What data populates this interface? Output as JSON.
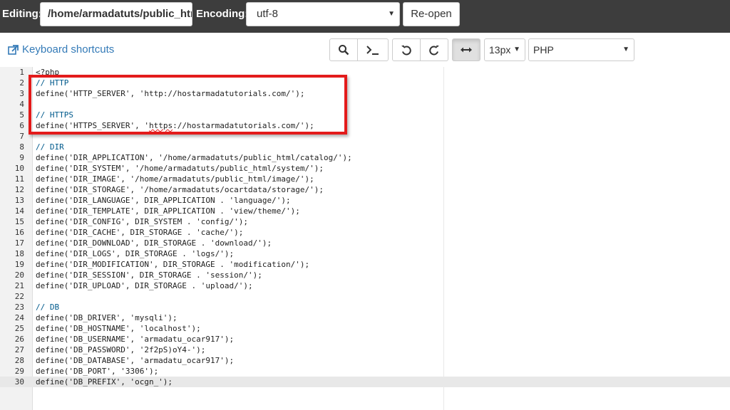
{
  "topbar": {
    "editing_label": "Editing:",
    "path_value": "/home/armadatuts/public_html",
    "encoding_label": "Encoding:",
    "encoding_value": "utf-8",
    "reopen_label": "Re-open"
  },
  "toolbar": {
    "keyboard_shortcuts_label": "Keyboard shortcuts",
    "font_size_value": "13px",
    "mode_value": "PHP",
    "icons": [
      "search-icon",
      "terminal-icon",
      "undo-icon",
      "redo-icon",
      "wrap-icon"
    ]
  },
  "colors": {
    "topbar": "#3d3d3d",
    "link": "#337ab7",
    "highlight_box": "#e31b1b"
  },
  "editor": {
    "active_line": 30,
    "lines": [
      {
        "n": "1",
        "t": "<?php"
      },
      {
        "n": "2",
        "t": "// HTTP"
      },
      {
        "n": "3",
        "t": "define('HTTP_SERVER', 'http://hostarmadatutorials.com/');"
      },
      {
        "n": "4",
        "t": ""
      },
      {
        "n": "5",
        "t": "// HTTPS"
      },
      {
        "n": "6",
        "t": "define('HTTPS_SERVER', 'https://hostarmadatutorials.com/');"
      },
      {
        "n": "7",
        "t": ""
      },
      {
        "n": "8",
        "t": "// DIR"
      },
      {
        "n": "9",
        "t": "define('DIR_APPLICATION', '/home/armadatuts/public_html/catalog/');"
      },
      {
        "n": "10",
        "t": "define('DIR_SYSTEM', '/home/armadatuts/public_html/system/');"
      },
      {
        "n": "11",
        "t": "define('DIR_IMAGE', '/home/armadatuts/public_html/image/');"
      },
      {
        "n": "12",
        "t": "define('DIR_STORAGE', '/home/armadatuts/ocartdata/storage/');"
      },
      {
        "n": "13",
        "t": "define('DIR_LANGUAGE', DIR_APPLICATION . 'language/');"
      },
      {
        "n": "14",
        "t": "define('DIR_TEMPLATE', DIR_APPLICATION . 'view/theme/');"
      },
      {
        "n": "15",
        "t": "define('DIR_CONFIG', DIR_SYSTEM . 'config/');"
      },
      {
        "n": "16",
        "t": "define('DIR_CACHE', DIR_STORAGE . 'cache/');"
      },
      {
        "n": "17",
        "t": "define('DIR_DOWNLOAD', DIR_STORAGE . 'download/');"
      },
      {
        "n": "18",
        "t": "define('DIR_LOGS', DIR_STORAGE . 'logs/');"
      },
      {
        "n": "19",
        "t": "define('DIR_MODIFICATION', DIR_STORAGE . 'modification/');"
      },
      {
        "n": "20",
        "t": "define('DIR_SESSION', DIR_STORAGE . 'session/');"
      },
      {
        "n": "21",
        "t": "define('DIR_UPLOAD', DIR_STORAGE . 'upload/');"
      },
      {
        "n": "22",
        "t": ""
      },
      {
        "n": "23",
        "t": "// DB"
      },
      {
        "n": "24",
        "t": "define('DB_DRIVER', 'mysqli');"
      },
      {
        "n": "25",
        "t": "define('DB_HOSTNAME', 'localhost');"
      },
      {
        "n": "26",
        "t": "define('DB_USERNAME', 'armadatu_ocar917');"
      },
      {
        "n": "27",
        "t": "define('DB_PASSWORD', '2f2pS)oY4-');"
      },
      {
        "n": "28",
        "t": "define('DB_DATABASE', 'armadatu_ocar917');"
      },
      {
        "n": "29",
        "t": "define('DB_PORT', '3306');"
      },
      {
        "n": "30",
        "t": "define('DB_PREFIX', 'ocgn_');"
      }
    ]
  }
}
